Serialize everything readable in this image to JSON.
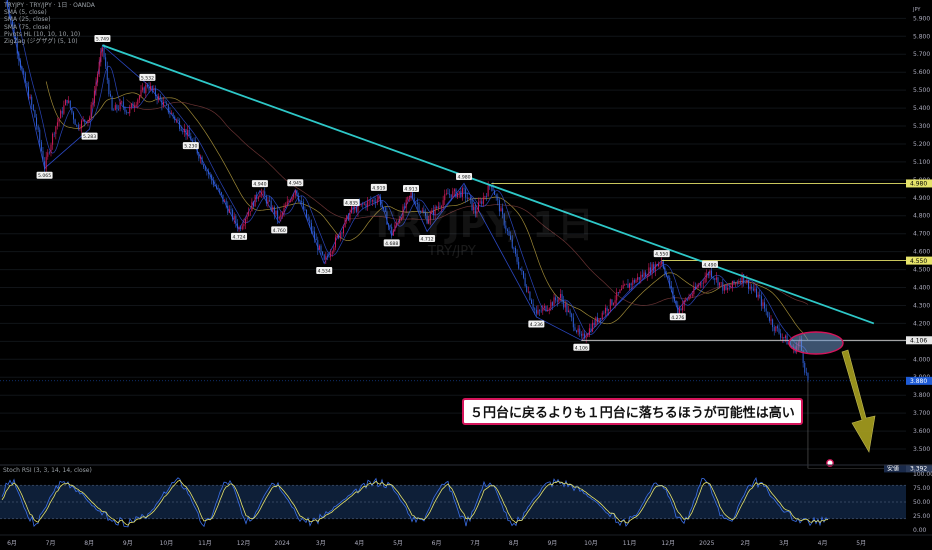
{
  "legend": [
    "TRYJPY · TRY/JPY · 1日 · OANDA",
    "SMA (5, close)",
    "SMA (25, close)",
    "SMA (75, close)",
    "Pivots HL (10, 10, 10, 10)",
    "ZigZag (ジグザグ) (5, 10)"
  ],
  "watermark": {
    "symbol": "TRYJPY, 1日",
    "pair": "TRY/JPY"
  },
  "callout": "５円台に戻るよりも１円台に落ちるほうが可能性は高い",
  "stoch_title": "Stoch RSI (3, 3, 14, 14, close)",
  "colors": {
    "background": "#000000",
    "up": "#d01c5c",
    "down": "#2f5fd8",
    "trendline": "#2ec8c8",
    "level": "#e6e36a",
    "sma_fast": "#3050d8",
    "sma_mid": "#b8a040",
    "sma_slow": "#7a3b3b",
    "arrow": "#a8a020",
    "ellipse": "#4fa8d8",
    "price_tag": "#1e5bd6",
    "stoch_k": "#3a6fe8",
    "stoch_d": "#e6e36a"
  },
  "chart_data": {
    "type": "candlestick",
    "y_axis": {
      "min": 3.45,
      "max": 5.98,
      "ticks": [
        5.9,
        5.8,
        5.7,
        5.6,
        5.5,
        5.4,
        5.3,
        5.2,
        5.1,
        5.0,
        4.9,
        4.8,
        4.7,
        4.6,
        4.5,
        4.4,
        4.3,
        4.2,
        4.1,
        4.0,
        3.9,
        3.8,
        3.7,
        3.6,
        3.5
      ],
      "unit_label": "JPY"
    },
    "x_axis": {
      "labels": [
        "6月",
        "7月",
        "8月",
        "9月",
        "10月",
        "11月",
        "12月",
        "2024",
        "3月",
        "4月",
        "5月",
        "6月",
        "7月",
        "8月",
        "9月",
        "10月",
        "11月",
        "12月",
        "2025",
        "2月",
        "3月",
        "4月",
        "5月"
      ]
    },
    "anchors": [
      {
        "t": 0,
        "p": 6.02
      },
      {
        "t": 10,
        "p": 5.6
      },
      {
        "t": 18,
        "p": 5.35
      },
      {
        "t": 24,
        "p": 5.07
      },
      {
        "t": 30,
        "p": 5.28
      },
      {
        "t": 38,
        "p": 5.45
      },
      {
        "t": 44,
        "p": 5.3
      },
      {
        "t": 52,
        "p": 5.35
      },
      {
        "t": 60,
        "p": 5.74
      },
      {
        "t": 66,
        "p": 5.38
      },
      {
        "t": 72,
        "p": 5.42
      },
      {
        "t": 76,
        "p": 5.38
      },
      {
        "t": 88,
        "p": 5.53
      },
      {
        "t": 100,
        "p": 5.4
      },
      {
        "t": 115,
        "p": 5.23
      },
      {
        "t": 128,
        "p": 5.0
      },
      {
        "t": 145,
        "p": 4.73
      },
      {
        "t": 158,
        "p": 4.94
      },
      {
        "t": 170,
        "p": 4.78
      },
      {
        "t": 180,
        "p": 4.95
      },
      {
        "t": 198,
        "p": 4.54
      },
      {
        "t": 215,
        "p": 4.83
      },
      {
        "t": 232,
        "p": 4.9
      },
      {
        "t": 240,
        "p": 4.7
      },
      {
        "t": 252,
        "p": 4.92
      },
      {
        "t": 262,
        "p": 4.78
      },
      {
        "t": 275,
        "p": 4.92
      },
      {
        "t": 285,
        "p": 4.93
      },
      {
        "t": 292,
        "p": 4.82
      },
      {
        "t": 302,
        "p": 4.98
      },
      {
        "t": 316,
        "p": 4.6
      },
      {
        "t": 330,
        "p": 4.25
      },
      {
        "t": 345,
        "p": 4.35
      },
      {
        "t": 358,
        "p": 4.11
      },
      {
        "t": 372,
        "p": 4.27
      },
      {
        "t": 385,
        "p": 4.4
      },
      {
        "t": 398,
        "p": 4.48
      },
      {
        "t": 408,
        "p": 4.55
      },
      {
        "t": 418,
        "p": 4.27
      },
      {
        "t": 428,
        "p": 4.38
      },
      {
        "t": 438,
        "p": 4.49
      },
      {
        "t": 448,
        "p": 4.38
      },
      {
        "t": 458,
        "p": 4.46
      },
      {
        "t": 468,
        "p": 4.35
      },
      {
        "t": 478,
        "p": 4.18
      },
      {
        "t": 486,
        "p": 4.1
      },
      {
        "t": 490,
        "p": 4.05
      },
      {
        "t": 494,
        "p": 4.1
      },
      {
        "t": 497,
        "p": 3.95
      },
      {
        "t": 499,
        "p": 3.88
      }
    ],
    "levels": [
      {
        "price": 4.98,
        "label": "4.980"
      },
      {
        "price": 4.55,
        "label": "4.550"
      },
      {
        "price": 4.106,
        "label": "4.106"
      }
    ],
    "last_price": {
      "price": 3.88,
      "label": "3.880"
    },
    "future_target": {
      "price": 3.392,
      "label": "3.392",
      "tag": "安値"
    },
    "trendline": {
      "from": {
        "t": 60,
        "p": 5.75
      },
      "to": {
        "t": 540,
        "p": 4.2
      }
    },
    "pivots": [
      {
        "t": 24,
        "p": 5.065,
        "label": "5.065",
        "kind": "low"
      },
      {
        "t": 60,
        "p": 5.749,
        "label": "5.749",
        "kind": "high"
      },
      {
        "t": 52,
        "p": 5.283,
        "label": "5.283",
        "kind": "low"
      },
      {
        "t": 88,
        "p": 5.532,
        "label": "5.532",
        "kind": "high"
      },
      {
        "t": 115,
        "p": 5.23,
        "label": "5.230",
        "kind": "low"
      },
      {
        "t": 145,
        "p": 4.724,
        "label": "4.724",
        "kind": "low"
      },
      {
        "t": 158,
        "p": 4.94,
        "label": "4.940",
        "kind": "high"
      },
      {
        "t": 170,
        "p": 4.76,
        "label": "4.760",
        "kind": "low"
      },
      {
        "t": 180,
        "p": 4.945,
        "label": "4.945",
        "kind": "high"
      },
      {
        "t": 198,
        "p": 4.534,
        "label": "4.534",
        "kind": "low"
      },
      {
        "t": 215,
        "p": 4.835,
        "label": "4.835",
        "kind": "high"
      },
      {
        "t": 232,
        "p": 4.919,
        "label": "4.919",
        "kind": "high"
      },
      {
        "t": 240,
        "p": 4.688,
        "label": "4.688",
        "kind": "low"
      },
      {
        "t": 252,
        "p": 4.913,
        "label": "4.913",
        "kind": "high"
      },
      {
        "t": 262,
        "p": 4.712,
        "label": "4.712",
        "kind": "low"
      },
      {
        "t": 285,
        "p": 4.98,
        "label": "4.980",
        "kind": "high"
      },
      {
        "t": 330,
        "p": 4.236,
        "label": "4.236",
        "kind": "low"
      },
      {
        "t": 358,
        "p": 4.106,
        "label": "4.106",
        "kind": "low"
      },
      {
        "t": 408,
        "p": 4.55,
        "label": "4.550",
        "kind": "high"
      },
      {
        "t": 418,
        "p": 4.276,
        "label": "4.276",
        "kind": "low"
      },
      {
        "t": 438,
        "p": 4.49,
        "label": "4.490",
        "kind": "high"
      }
    ],
    "stoch": {
      "y_ticks": [
        100,
        75,
        50,
        25,
        0
      ],
      "band": [
        80,
        20
      ]
    }
  }
}
